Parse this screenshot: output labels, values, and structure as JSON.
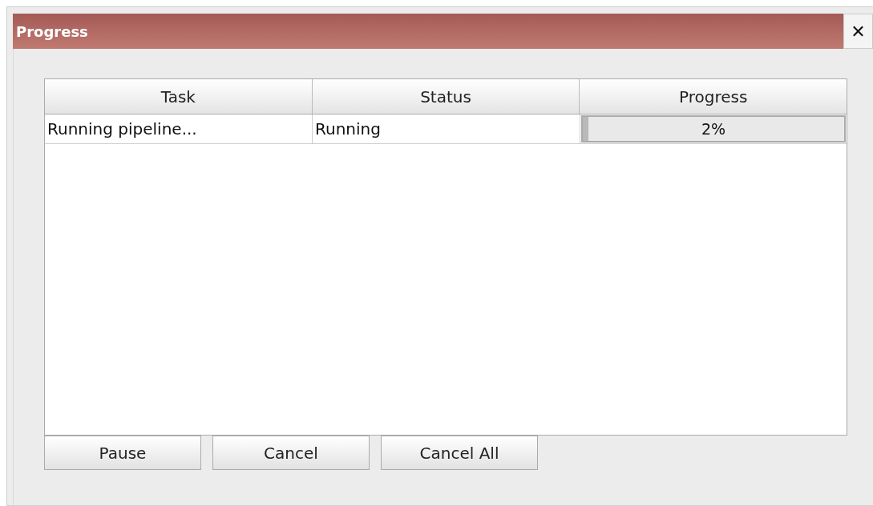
{
  "window": {
    "title": "Progress",
    "close": "✕"
  },
  "table": {
    "columns": [
      "Task",
      "Status",
      "Progress"
    ],
    "rows": [
      {
        "task": "Running pipeline...",
        "status": "Running",
        "progress": {
          "level": 0.02,
          "text": "2%"
        }
      }
    ]
  },
  "buttons": [
    "Pause",
    "Cancel",
    "Cancel All"
  ]
}
